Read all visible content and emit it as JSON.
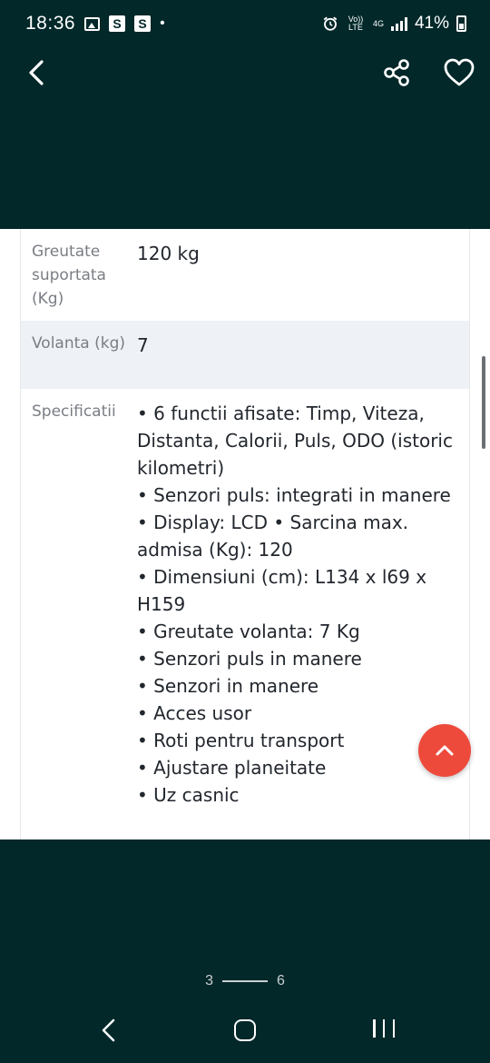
{
  "status_bar": {
    "time": "18:36",
    "notif_s1": "S",
    "notif_s2": "S",
    "notif_dot": "•",
    "volte": "Vo)) LTE",
    "network": "4G",
    "battery_pct": "41%"
  },
  "header": {
    "icons": [
      "back-arrow-icon",
      "share-icon",
      "heart-icon"
    ]
  },
  "specs": [
    {
      "label": "Greutate suportata (Kg)",
      "value": "120 kg"
    },
    {
      "label": "Volanta (kg)",
      "value": "7"
    },
    {
      "label": "Specificatii",
      "bullets": [
        "• 6 functii afisate: Timp, Viteza, Distanta, Calorii, Puls, ODO (istoric kilometri)",
        "• Senzori puls: integrati in manere",
        "• Display: LCD • Sarcina max. admisa (Kg): 120",
        "• Dimensiuni (cm): L134 x l69 x H159",
        "• Greutate volanta: 7 Kg",
        "• Senzori puls in manere",
        "• Senzori in manere",
        "• Acces usor",
        "• Roti pentru transport",
        "• Ajustare planeitate",
        "• Uz casnic"
      ]
    }
  ],
  "pagination": {
    "current": "3",
    "total": "6"
  },
  "colors": {
    "header_bg": "#02282a",
    "scroll_top_button": "#ee4a3c",
    "alt_row": "#eef2f6"
  }
}
